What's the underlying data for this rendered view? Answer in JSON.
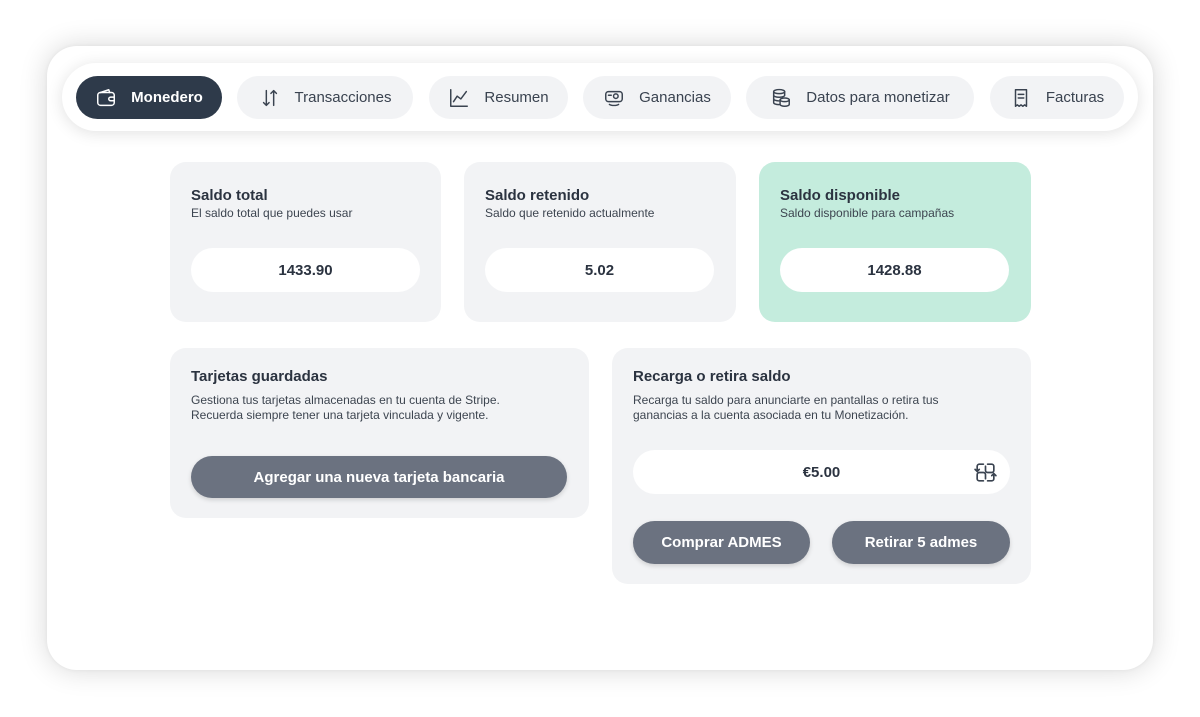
{
  "tabs": [
    {
      "label": "Monedero",
      "icon": "wallet-icon",
      "active": true
    },
    {
      "label": "Transacciones",
      "icon": "sort-arrows-icon",
      "active": false
    },
    {
      "label": "Resumen",
      "icon": "line-chart-icon",
      "active": false
    },
    {
      "label": "Ganancias",
      "icon": "earnings-icon",
      "active": false
    },
    {
      "label": "Datos para monetizar",
      "icon": "coins-icon",
      "active": false
    },
    {
      "label": "Facturas",
      "icon": "receipt-icon",
      "active": false
    }
  ],
  "balances": {
    "total": {
      "title": "Saldo total",
      "subtitle": "El saldo total que puedes usar",
      "value": "1433.90"
    },
    "retained": {
      "title": "Saldo retenido",
      "subtitle": "Saldo que retenido actualmente",
      "value": "5.02"
    },
    "available": {
      "title": "Saldo disponible",
      "subtitle": "Saldo disponible para campañas",
      "value": "1428.88"
    }
  },
  "cards": {
    "title": "Tarjetas guardadas",
    "desc_line1": "Gestiona tus tarjetas almacenadas en tu cuenta de Stripe.",
    "desc_line2": "Recuerda siempre tener una tarjeta vinculada y vigente.",
    "add_button": "Agregar una nueva tarjeta bancaria"
  },
  "recharge": {
    "title": "Recarga o retira saldo",
    "desc_line1": "Recarga tu saldo para anunciarte en pantallas o retira tus",
    "desc_line2": "ganancias a la cuenta asociada en tu Monetización.",
    "amount": "€5.00",
    "amount_icon": "exchange-icon",
    "buy_button": "Comprar ADMES",
    "withdraw_button": "Retirar 5 admes"
  },
  "colors": {
    "active_tab": "#2e3a4a",
    "available_card": "#c4ecdd",
    "button": "#6b7280",
    "card_bg": "#f2f3f5"
  }
}
